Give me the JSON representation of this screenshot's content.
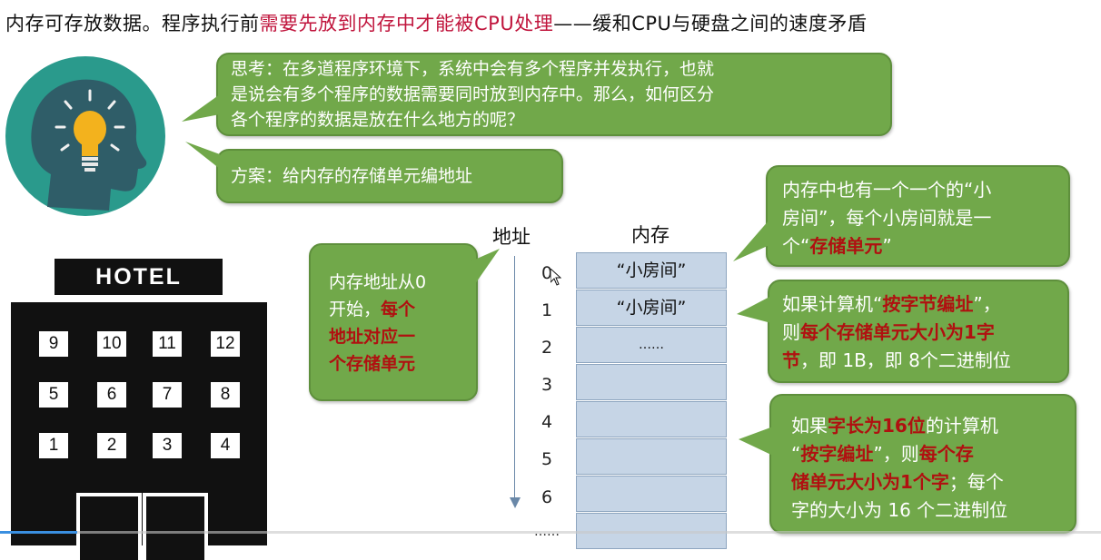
{
  "title": {
    "part1": "内存可存放数据。程序执行前",
    "part2": "需要先放到内存中才能被CPU处理",
    "part3": "——缓和CPU与硬盘之间的速度矛盾"
  },
  "bubbles": {
    "think": {
      "line1": "思考：在多道程序环境下，系统中会有多个程序并发执行，也就",
      "line2": "是说会有多个程序的数据需要同时放到内存中。那么，如何区分",
      "line3": "各个程序的数据是放在什么地方的呢？"
    },
    "plan": {
      "text": "方案：给内存的存储单元编地址"
    },
    "address": {
      "line1": "内存地址从0",
      "line2a": "开始，",
      "line2b": "每个",
      "line3": "地址对应一",
      "line4": "个存储单元"
    },
    "room": {
      "line1": "内存中也有一个一个的“小",
      "line2": "房间”，每个小房间就是一",
      "line3a": "个“",
      "line3b": "存储单元",
      "line3c": "”"
    },
    "byte": {
      "line1a": "如果计算机“",
      "line1b": "按字节编址",
      "line1c": "”，",
      "line2a": "则",
      "line2b": "每个存储单元大小为",
      "line2c": "1字",
      "line3a": "节",
      "line3b": "，即 1B，即 8个二进制位"
    },
    "word": {
      "line1a": "如果",
      "line1b": "字长为16位",
      "line1c": "的计算机",
      "line2a": "“",
      "line2b": "按字编址",
      "line2c": "”，则",
      "line2d": "每个存",
      "line3a": "储单元大小为",
      "line3b": "1个字",
      "line3c": "；每个",
      "line4": "字的大小为 16 个二进制位"
    }
  },
  "hotel": {
    "sign": "HOTEL",
    "rows": [
      [
        "9",
        "10",
        "11",
        "12"
      ],
      [
        "5",
        "6",
        "7",
        "8"
      ],
      [
        "1",
        "2",
        "3",
        "4"
      ]
    ]
  },
  "memory": {
    "addr_header": "地址",
    "mem_header": "内存",
    "addresses": [
      "0",
      "1",
      "2",
      "3",
      "4",
      "5",
      "6",
      "……"
    ],
    "cells": [
      "“小房间”",
      "“小房间”",
      "……",
      "",
      "",
      "",
      "",
      ""
    ]
  },
  "colors": {
    "bubble_green": "#71a84a",
    "highlight_red": "#c0143c",
    "cell_blue": "#c6d5e6",
    "head_teal": "#2a9a8c"
  },
  "video": {
    "progress": 0.07
  }
}
